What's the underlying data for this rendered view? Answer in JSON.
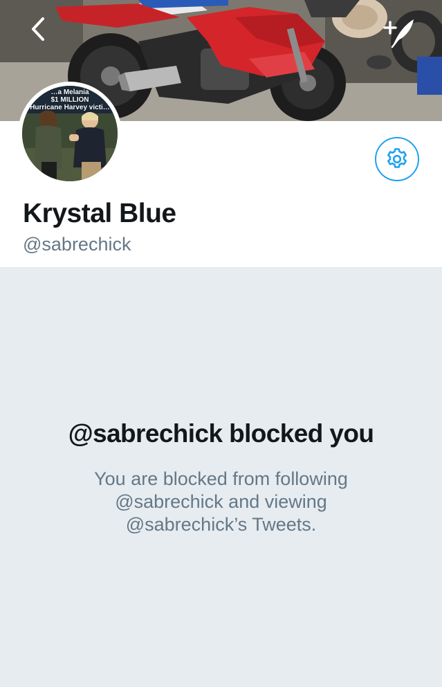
{
  "header": {
    "back_icon": "chevron-left-icon",
    "compose_icon": "compose-tweet-icon"
  },
  "avatar_caption": {
    "line1": "…a Melania",
    "line2": "$1 MILLION",
    "line3": "Hurricane Harvey victi…"
  },
  "profile": {
    "display_name": "Krystal Blue",
    "handle": "@sabrechick",
    "settings_icon": "gear-icon"
  },
  "blocked": {
    "title": "@sabrechick blocked you",
    "description": "You are blocked from following @sabrechick and viewing @sabrechick’s Tweets."
  },
  "colors": {
    "accent": "#1da1f2",
    "text_primary": "#14171a",
    "text_secondary": "#657786",
    "background": "#e6ecf0"
  }
}
